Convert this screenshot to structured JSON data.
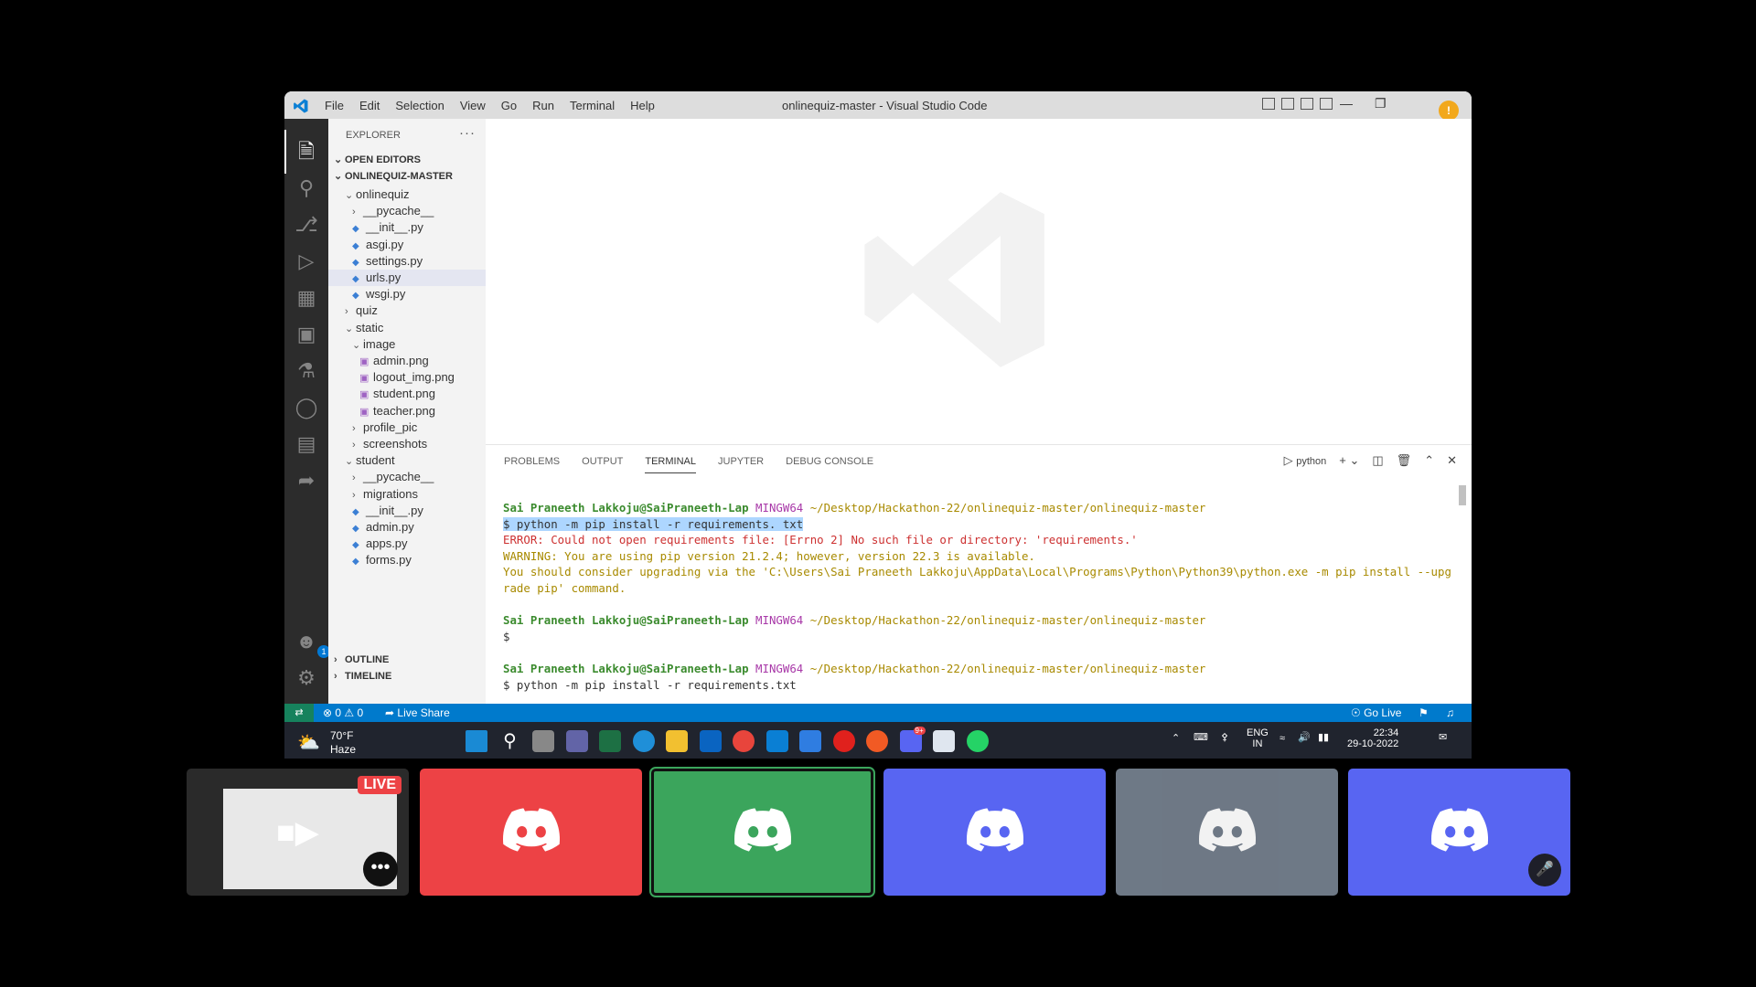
{
  "window": {
    "title": "onlinequiz-master - Visual Studio Code"
  },
  "menu": [
    "File",
    "Edit",
    "Selection",
    "View",
    "Go",
    "Run",
    "Terminal",
    "Help"
  ],
  "explorer": {
    "header": "EXPLORER",
    "open_editors": "OPEN EDITORS",
    "project": "ONLINEQUIZ-MASTER",
    "tree": [
      {
        "label": "onlinequiz",
        "kind": "folder-open",
        "indent": 1
      },
      {
        "label": "__pycache__",
        "kind": "folder",
        "indent": 2
      },
      {
        "label": "__init__.py",
        "kind": "py",
        "indent": 2
      },
      {
        "label": "asgi.py",
        "kind": "py",
        "indent": 2
      },
      {
        "label": "settings.py",
        "kind": "py",
        "indent": 2
      },
      {
        "label": "urls.py",
        "kind": "py",
        "indent": 2,
        "selected": true
      },
      {
        "label": "wsgi.py",
        "kind": "py",
        "indent": 2
      },
      {
        "label": "quiz",
        "kind": "folder",
        "indent": 1
      },
      {
        "label": "static",
        "kind": "folder-open",
        "indent": 1
      },
      {
        "label": "image",
        "kind": "folder-open",
        "indent": 2
      },
      {
        "label": "admin.png",
        "kind": "png",
        "indent": 3
      },
      {
        "label": "logout_img.png",
        "kind": "png",
        "indent": 3
      },
      {
        "label": "student.png",
        "kind": "png",
        "indent": 3
      },
      {
        "label": "teacher.png",
        "kind": "png",
        "indent": 3
      },
      {
        "label": "profile_pic",
        "kind": "folder",
        "indent": 2
      },
      {
        "label": "screenshots",
        "kind": "folder",
        "indent": 2
      },
      {
        "label": "student",
        "kind": "folder-open",
        "indent": 1
      },
      {
        "label": "__pycache__",
        "kind": "folder",
        "indent": 2
      },
      {
        "label": "migrations",
        "kind": "folder",
        "indent": 2
      },
      {
        "label": "__init__.py",
        "kind": "py",
        "indent": 2
      },
      {
        "label": "admin.py",
        "kind": "py",
        "indent": 2
      },
      {
        "label": "apps.py",
        "kind": "py",
        "indent": 2
      },
      {
        "label": "forms.py",
        "kind": "py",
        "indent": 2
      }
    ],
    "outline": "OUTLINE",
    "timeline": "TIMELINE"
  },
  "panel": {
    "tabs": [
      "PROBLEMS",
      "OUTPUT",
      "TERMINAL",
      "JUPYTER",
      "DEBUG CONSOLE"
    ],
    "active_tab": "TERMINAL",
    "terminal_name": "python"
  },
  "terminal": {
    "user": "Sai Praneeth Lakkoju@SaiPraneeth-Lap",
    "shell": "MINGW64",
    "cwd": "~/Desktop/Hackathon-22/onlinequiz-master/onlinequiz-master",
    "cmd1": "$ python -m pip install -r requirements. txt",
    "error": "ERROR: Could not open requirements file: [Errno 2] No such file or directory: 'requirements.'",
    "warning1": "WARNING: You are using pip version 21.2.4; however, version 22.3 is available.",
    "warning2": "You should consider upgrading via the 'C:\\Users\\Sai Praneeth Lakkoju\\AppData\\Local\\Programs\\Python\\Python39\\python.exe -m pip install --upg",
    "warning3": "rade pip' command.",
    "prompt": "$",
    "cmd2": "$ python -m pip install -r requirements.txt"
  },
  "statusbar": {
    "errors": "0",
    "warnings": "0",
    "live_share": "Live Share",
    "go_live": "Go Live"
  },
  "taskbar": {
    "temp": "70°F",
    "weather": "Haze",
    "lang1": "ENG",
    "lang2": "IN",
    "time": "22:34",
    "date": "29-10-2022",
    "discord_badge": "9+"
  },
  "discord": {
    "live_label": "LIVE",
    "tile_colors": [
      "#ed4245",
      "#3ba55c",
      "#5865f2",
      "#747f8d",
      "#5865f2"
    ]
  },
  "colors": {
    "accent": "#007acc",
    "remote": "#16825d"
  }
}
